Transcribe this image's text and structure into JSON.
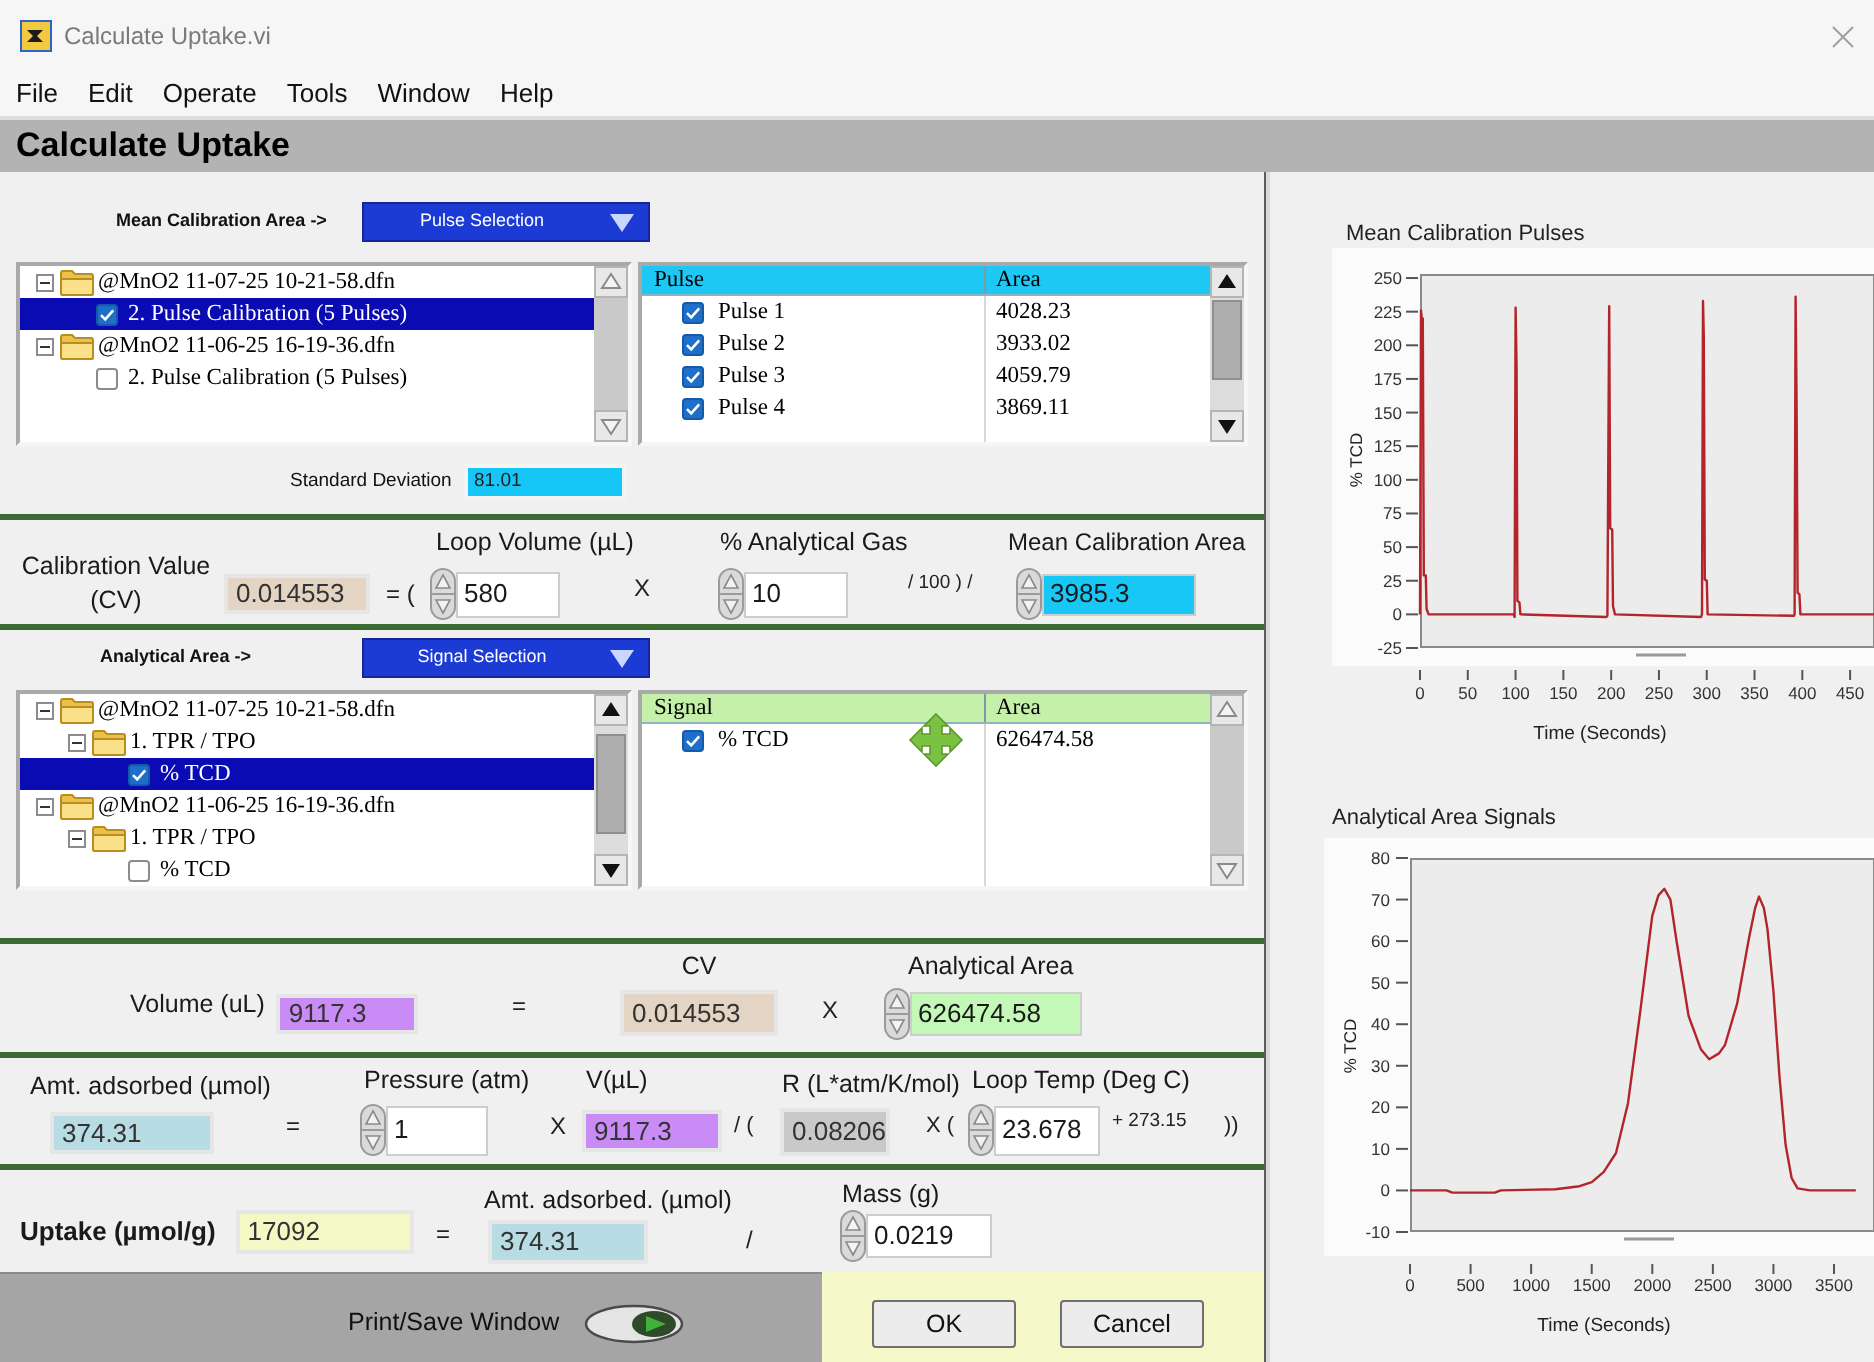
{
  "window": {
    "title": "Calculate Uptake.vi"
  },
  "menu": [
    "File",
    "Edit",
    "Operate",
    "Tools",
    "Window",
    "Help"
  ],
  "panel_title": "Calculate Uptake",
  "sections": [
    {
      "kind": "selection",
      "heading": "Mean Calibration Area ->",
      "selector": "Pulse Selection",
      "tree": [
        {
          "kind": "folder",
          "label": "@MnO2 11-07-25 10-21-58.dfn",
          "expanded": true,
          "selected": false,
          "children": [
            {
              "kind": "item",
              "label": "2. Pulse Calibration (5 Pulses)",
              "checked": true,
              "selected": true
            }
          ]
        },
        {
          "kind": "folder",
          "label": "@MnO2 11-06-25 16-19-36.dfn",
          "expanded": true,
          "selected": false,
          "children": [
            {
              "kind": "item",
              "label": "2. Pulse Calibration (5 Pulses)",
              "checked": false,
              "selected": false
            }
          ]
        }
      ],
      "table": {
        "color": "#1ec8f5",
        "columns": [
          "Pulse",
          "Area"
        ],
        "rows": [
          {
            "label": "Pulse 1",
            "checked": true,
            "area": "4028.23"
          },
          {
            "label": "Pulse 2",
            "checked": true,
            "area": "3933.02"
          },
          {
            "label": "Pulse 3",
            "checked": true,
            "area": "4059.79"
          },
          {
            "label": "Pulse 4",
            "checked": true,
            "area": "3869.11"
          }
        ]
      },
      "statistic": {
        "label": "Standard Deviation",
        "value": "81.01",
        "color": "#15c6f6"
      }
    },
    {
      "kind": "equation",
      "terms": [
        {
          "kind": "indicator",
          "label": "Calibration Value (CV)",
          "value": "0.014553",
          "color": "#e3d4c3"
        },
        {
          "kind": "operator",
          "text": "= ("
        },
        {
          "kind": "control",
          "label": "Loop Volume (µL)",
          "value": "580",
          "color": "#ffffff"
        },
        {
          "kind": "operator",
          "text": "X"
        },
        {
          "kind": "control",
          "label": "% Analytical Gas",
          "value": "10",
          "color": "#ffffff"
        },
        {
          "kind": "constant",
          "text": "/ 100 ) /"
        },
        {
          "kind": "control",
          "label": "Mean Calibration Area",
          "value": "3985.3",
          "color": "#18c7f6"
        }
      ]
    },
    {
      "kind": "selection",
      "heading": "Analytical Area ->",
      "selector": "Signal Selection",
      "tree": [
        {
          "kind": "folder",
          "label": "@MnO2 11-07-25 10-21-58.dfn",
          "expanded": true,
          "selected": false,
          "children": [
            {
              "kind": "folder",
              "label": "1. TPR / TPO",
              "expanded": true,
              "selected": false,
              "children": [
                {
                  "kind": "item",
                  "label": "% TCD",
                  "checked": true,
                  "selected": true
                }
              ]
            }
          ]
        },
        {
          "kind": "folder",
          "label": "@MnO2 11-06-25 16-19-36.dfn",
          "expanded": true,
          "selected": false,
          "children": [
            {
              "kind": "folder",
              "label": "1. TPR / TPO",
              "expanded": true,
              "selected": false,
              "children": [
                {
                  "kind": "item",
                  "label": "% TCD",
                  "checked": false,
                  "selected": false
                }
              ]
            }
          ]
        }
      ],
      "table": {
        "color": "#c5f0aa",
        "columns": [
          "Signal",
          "Area"
        ],
        "rows": [
          {
            "label": "% TCD",
            "checked": true,
            "area": "626474.58"
          }
        ]
      }
    },
    {
      "kind": "equation",
      "terms": [
        {
          "kind": "indicator",
          "label": "Volume (uL)",
          "value": "9117.3",
          "color": "#c98cf6"
        },
        {
          "kind": "operator",
          "text": "="
        },
        {
          "kind": "indicator",
          "label": "CV",
          "value": "0.014553",
          "color": "#e3d4c3"
        },
        {
          "kind": "operator",
          "text": "X"
        },
        {
          "kind": "control",
          "label": "Analytical Area",
          "value": "626474.58",
          "color": "#c3f8b8"
        }
      ]
    },
    {
      "kind": "equation",
      "terms": [
        {
          "kind": "indicator",
          "label": "Amt. adsorbed (µmol)",
          "value": "374.31",
          "color": "#b8dce4"
        },
        {
          "kind": "operator",
          "text": "="
        },
        {
          "kind": "control",
          "label": "Pressure (atm)",
          "value": "1",
          "color": "#ffffff"
        },
        {
          "kind": "operator",
          "text": "X"
        },
        {
          "kind": "indicator",
          "label": "V(µL)",
          "value": "9117.3",
          "color": "#c98cf6"
        },
        {
          "kind": "operator",
          "text": "/ ("
        },
        {
          "kind": "indicator",
          "label": "R (L*atm/K/mol)",
          "value": "0.08206",
          "color": "#c9c9c9"
        },
        {
          "kind": "operator",
          "text": "X ("
        },
        {
          "kind": "control",
          "label": "Loop Temp (Deg C)",
          "value": "23.678",
          "color": "#ffffff"
        },
        {
          "kind": "constant",
          "text": "+ 273.15"
        },
        {
          "kind": "operator",
          "text": "))"
        }
      ]
    },
    {
      "kind": "equation",
      "terms": [
        {
          "kind": "indicator",
          "label": "Uptake (µmol/g)",
          "value": "17092",
          "color": "#f4f8c4"
        },
        {
          "kind": "operator",
          "text": "="
        },
        {
          "kind": "indicator",
          "label": "Amt. adsorbed. (µmol)",
          "value": "374.31",
          "color": "#b8dce4"
        },
        {
          "kind": "operator",
          "text": "/"
        },
        {
          "kind": "control",
          "label": "Mass (g)",
          "value": "0.0219",
          "color": "#ffffff"
        }
      ]
    }
  ],
  "bottom_bar": {
    "toggle": {
      "label": "Print/Save Window",
      "on": true
    },
    "buttons": [
      "OK",
      "Cancel"
    ]
  },
  "graphs": [
    {
      "chart_data": {
        "type": "line",
        "title": "Mean Calibration Pulses",
        "xlabel": "Time (Seconds)",
        "ylabel": "% TCD",
        "x": [
          0,
          1,
          2,
          3,
          4,
          6,
          7,
          9,
          98,
          99,
          100,
          101,
          102,
          104,
          105,
          195,
          196,
          197,
          198,
          199,
          201,
          202,
          204,
          294,
          295,
          296,
          297,
          298,
          300,
          301,
          391,
          392,
          393,
          394,
          395,
          397,
          398,
          475
        ],
        "series": [
          {
            "color": "#b3242b",
            "values": [
              0,
              226,
              218,
              220,
              29,
              29,
              4,
              0,
              0,
              -2,
              228,
              182,
              10,
              9,
              0,
              -2,
              -1,
              104,
              229,
              64,
              63,
              6,
              0,
              -2,
              0,
              233,
              206,
              26,
              25,
              0,
              -1,
              0,
              236,
              156,
              16,
              15,
              0,
              0
            ]
          }
        ],
        "xlim": [
          0,
          475
        ],
        "ylim": [
          -25,
          253
        ],
        "xticks": [
          0,
          50,
          100,
          150,
          200,
          250,
          300,
          350,
          400,
          450
        ],
        "yticks": [
          -25,
          0,
          25,
          50,
          75,
          100,
          125,
          150,
          175,
          200,
          225,
          250
        ]
      }
    },
    {
      "chart_data": {
        "type": "line",
        "title": "Analytical Area Signals",
        "xlabel": "Time (Seconds)",
        "ylabel": "% TCD",
        "x": [
          0,
          300,
          350,
          700,
          750,
          1200,
          1400,
          1500,
          1600,
          1700,
          1800,
          1900,
          2000,
          2050,
          2100,
          2150,
          2200,
          2300,
          2400,
          2470,
          2550,
          2600,
          2700,
          2800,
          2850,
          2880,
          2920,
          2950,
          3000,
          3050,
          3100,
          3150,
          3200,
          3300,
          3680
        ],
        "series": [
          {
            "color": "#b3242b",
            "values": [
              0,
              0,
              -0.5,
              -0.5,
              0,
              0.3,
              1,
              2,
              4.5,
              9,
              21,
              43,
              66,
              71,
              72.6,
              70,
              60,
              42,
              34,
              31.6,
              33,
              35,
              45,
              61,
              68,
              70.7,
              68,
              63,
              48,
              27,
              11,
              3,
              0.5,
              0,
              0
            ]
          }
        ],
        "xlim": [
          0,
          3830
        ],
        "ylim": [
          -10,
          80
        ],
        "xticks": [
          0,
          500,
          1000,
          1500,
          2000,
          2500,
          3000,
          3500
        ],
        "yticks": [
          -10,
          0,
          10,
          20,
          30,
          40,
          50,
          60,
          70,
          80
        ]
      }
    }
  ]
}
